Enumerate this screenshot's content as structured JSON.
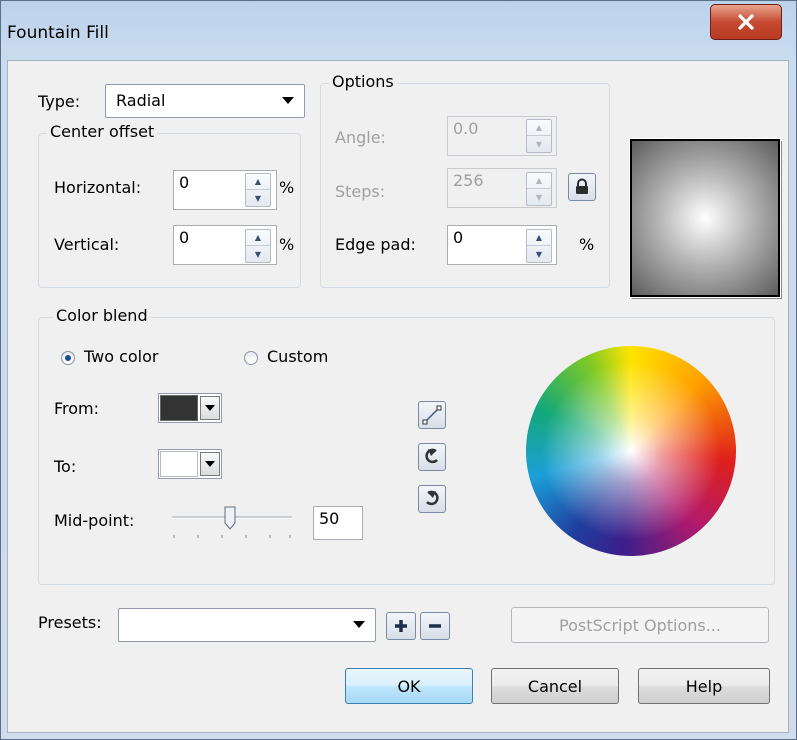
{
  "window": {
    "title": "Fountain Fill",
    "close_glyph": "x"
  },
  "type": {
    "label": "Type:",
    "value": "Radial"
  },
  "center_offset": {
    "legend": "Center offset",
    "horizontal_label": "Horizontal:",
    "horizontal_value": "0",
    "horizontal_unit": "%",
    "vertical_label": "Vertical:",
    "vertical_value": "0",
    "vertical_unit": "%"
  },
  "options": {
    "legend": "Options",
    "angle_label": "Angle:",
    "angle_value": "0.0",
    "steps_label": "Steps:",
    "steps_value": "256",
    "edge_pad_label": "Edge pad:",
    "edge_pad_value": "0",
    "edge_pad_unit": "%"
  },
  "color_blend": {
    "legend": "Color blend",
    "two_color_label": "Two color",
    "custom_label": "Custom",
    "selected_mode": "Two color",
    "from_label": "From:",
    "from_color": "#333333",
    "to_label": "To:",
    "to_color": "#ffffff",
    "midpoint_label": "Mid-point:",
    "midpoint_value": "50"
  },
  "blend_direction_icons": [
    "line-blend-icon",
    "counterclockwise-blend-icon",
    "clockwise-blend-icon"
  ],
  "presets": {
    "label": "Presets:",
    "value": ""
  },
  "buttons": {
    "postscript": "PostScript Options...",
    "ok": "OK",
    "cancel": "Cancel",
    "help": "Help"
  },
  "colors": {
    "accent": "#3c7fb1",
    "close": "#c64b32",
    "background": "#f0f0f0"
  }
}
